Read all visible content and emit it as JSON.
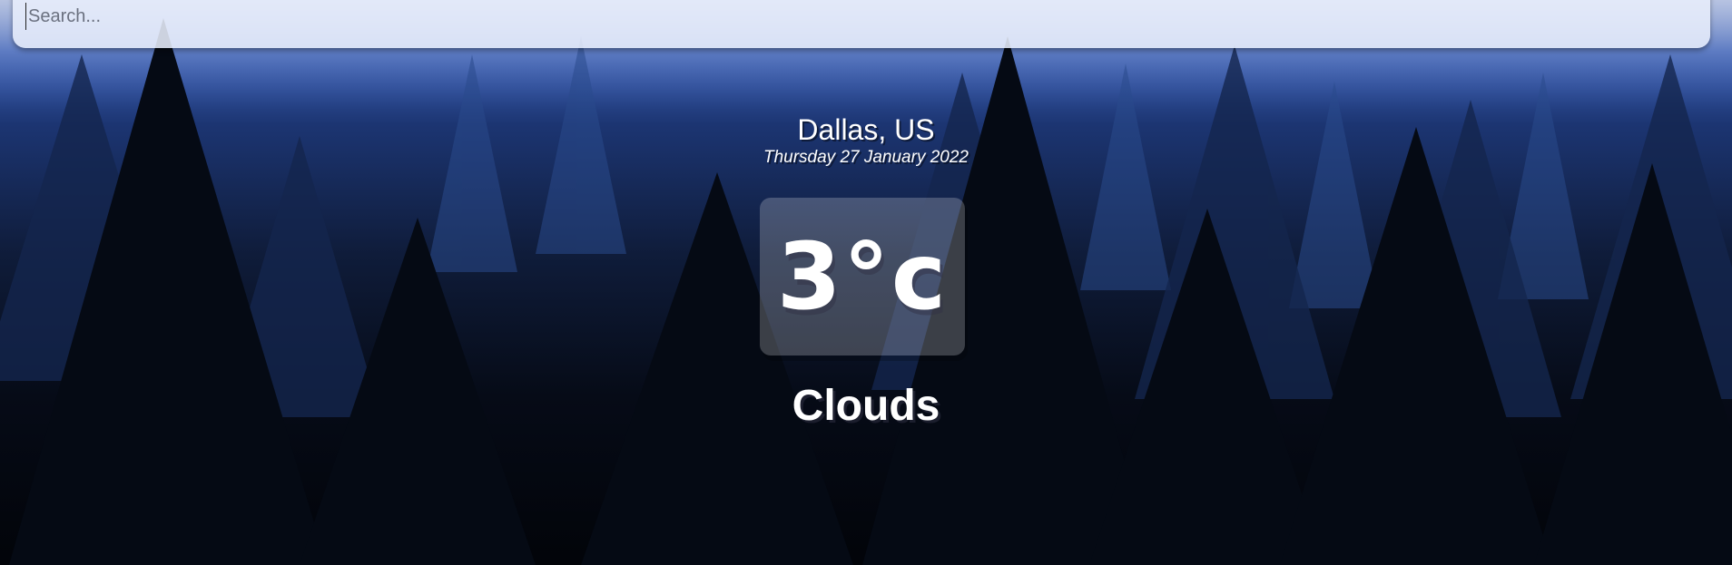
{
  "search": {
    "placeholder": "Search...",
    "value": ""
  },
  "location": {
    "name": "Dallas, US",
    "date": "Thursday 27 January 2022"
  },
  "weather": {
    "temperature": "3°c",
    "condition": "Clouds"
  },
  "colors": {
    "sky_top": "#a9b8dd",
    "sky_mid": "#3f63b8",
    "forest_dark": "#020409",
    "text": "#ffffff"
  }
}
